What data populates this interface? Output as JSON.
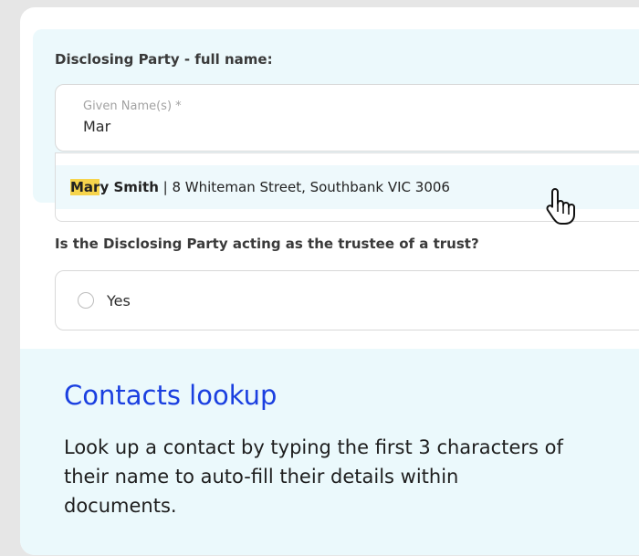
{
  "form": {
    "section_label": "Disclosing Party - full name:",
    "given_name_label": "Given Name(s) *",
    "given_name_value": "Mar",
    "suggestion": {
      "match": "Mar",
      "name_rest": "y Smith",
      "separator": " | ",
      "address": "8 Whiteman Street, Southbank VIC 3006"
    },
    "trust_question": "Is the Disclosing Party acting as the trustee of a trust?",
    "trust_option_yes": "Yes"
  },
  "info": {
    "title": "Contacts lookup",
    "body": "Look up a contact by typing the first 3 characters of their name to auto-fill their details within documents."
  },
  "colors": {
    "accent_title": "#1a3fe0",
    "panel_bg": "#ebf9fc",
    "highlight": "#f6d44c"
  }
}
